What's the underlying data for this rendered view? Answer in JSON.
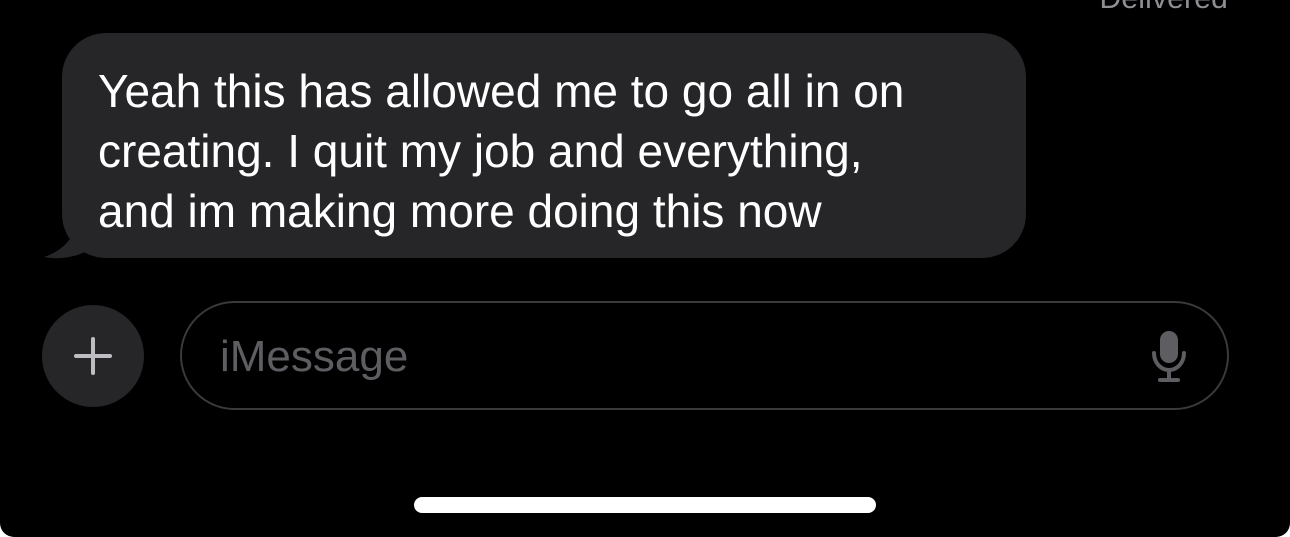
{
  "status": {
    "delivered": "Delivered"
  },
  "message": {
    "lines": [
      "Yeah this has allowed me to go all in on",
      "creating. I quit my job and everything,",
      "and im making more doing this now"
    ]
  },
  "composer": {
    "placeholder": "iMessage",
    "plus_icon": "plus-icon",
    "mic_icon": "microphone-icon"
  },
  "colors": {
    "background": "#000000",
    "bubble": "#262628",
    "text": "#ffffff",
    "secondary_text": "#8e8e93",
    "field_border": "#3a3a3c"
  }
}
